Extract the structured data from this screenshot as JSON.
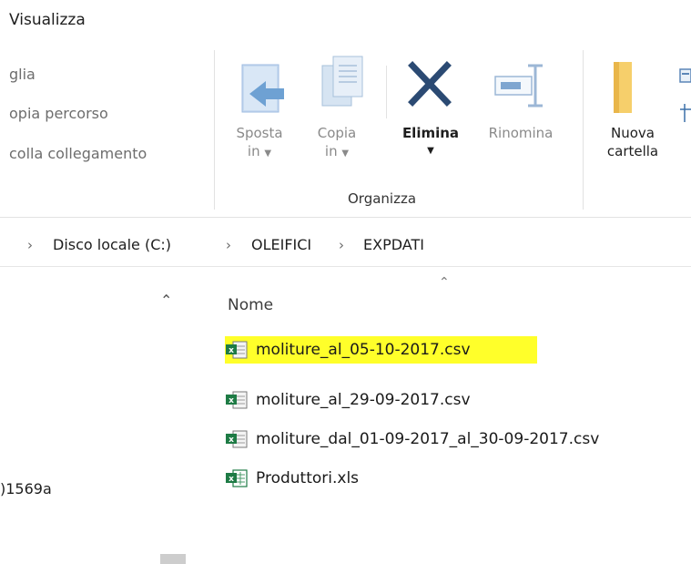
{
  "ribbon": {
    "tab_label": "Visualizza",
    "clipboard": {
      "items": [
        "glia",
        "opia percorso",
        "colla collegamento"
      ]
    },
    "organize": {
      "group_label": "Organizza",
      "move_to": {
        "line1": "Sposta",
        "line2": "in"
      },
      "copy_to": {
        "line1": "Copia",
        "line2": "in"
      },
      "delete": {
        "label": "Elimina"
      },
      "rename": {
        "label": "Rinomina"
      }
    },
    "new": {
      "new_folder": {
        "line1": "Nuova",
        "line2": "cartella"
      }
    }
  },
  "address_bar": {
    "crumbs": [
      "Disco locale (C:)",
      "OLEIFICI",
      "EXPDATI"
    ]
  },
  "nav_pane": {
    "item_label": ")1569a"
  },
  "file_list": {
    "column_header": "Nome",
    "files": [
      {
        "name": "moliture_al_05-10-2017.csv",
        "icon": "excel-csv-icon",
        "highlighted": true
      },
      {
        "name": "moliture_al_29-09-2017.csv",
        "icon": "excel-csv-icon",
        "highlighted": false
      },
      {
        "name": "moliture_dal_01-09-2017_al_30-09-2017.csv",
        "icon": "excel-csv-icon",
        "highlighted": false
      },
      {
        "name": "Produttori.xls",
        "icon": "excel-xls-icon",
        "highlighted": false
      }
    ]
  },
  "colors": {
    "highlight": "#ffff2a",
    "excel_green": "#1e7b45",
    "move_icon_blue": "#8fb8dd",
    "delete_icon": "#2b4a73",
    "folder_yellow": "#f6cf6b"
  }
}
